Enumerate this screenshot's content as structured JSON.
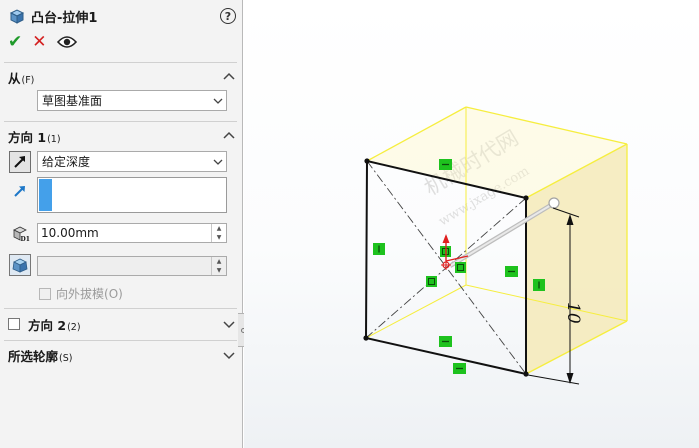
{
  "feature": {
    "title": "凸台-拉伸1",
    "help_label": "?"
  },
  "actions": {
    "ok_label": "✔",
    "cancel_label": "✕",
    "preview_label": "preview"
  },
  "from_section": {
    "label": "从",
    "hint": "(F)",
    "start_condition": "草图基准面"
  },
  "direction1": {
    "label": "方向 1",
    "hint": "(1)",
    "end_condition": "给定深度",
    "depth_value": "10.00mm",
    "draft_value": "",
    "draft_outward_label": "向外拔模",
    "draft_outward_hint": "(O)",
    "draft_outward_checked": false
  },
  "direction2": {
    "label": "方向 2",
    "hint": "(2)",
    "checked": false
  },
  "selected_contours": {
    "label": "所选轮廓",
    "hint": "(S)"
  },
  "viewport": {
    "dimension_text": "10",
    "watermark_line1": "机械时代网",
    "watermark_line2": "www.jxage.com",
    "colors": {
      "preview_yellow": "#f6ee3f",
      "preview_fill": "#f5eab8",
      "constraint_green": "#1ec21e",
      "origin_red": "#e02020"
    }
  }
}
